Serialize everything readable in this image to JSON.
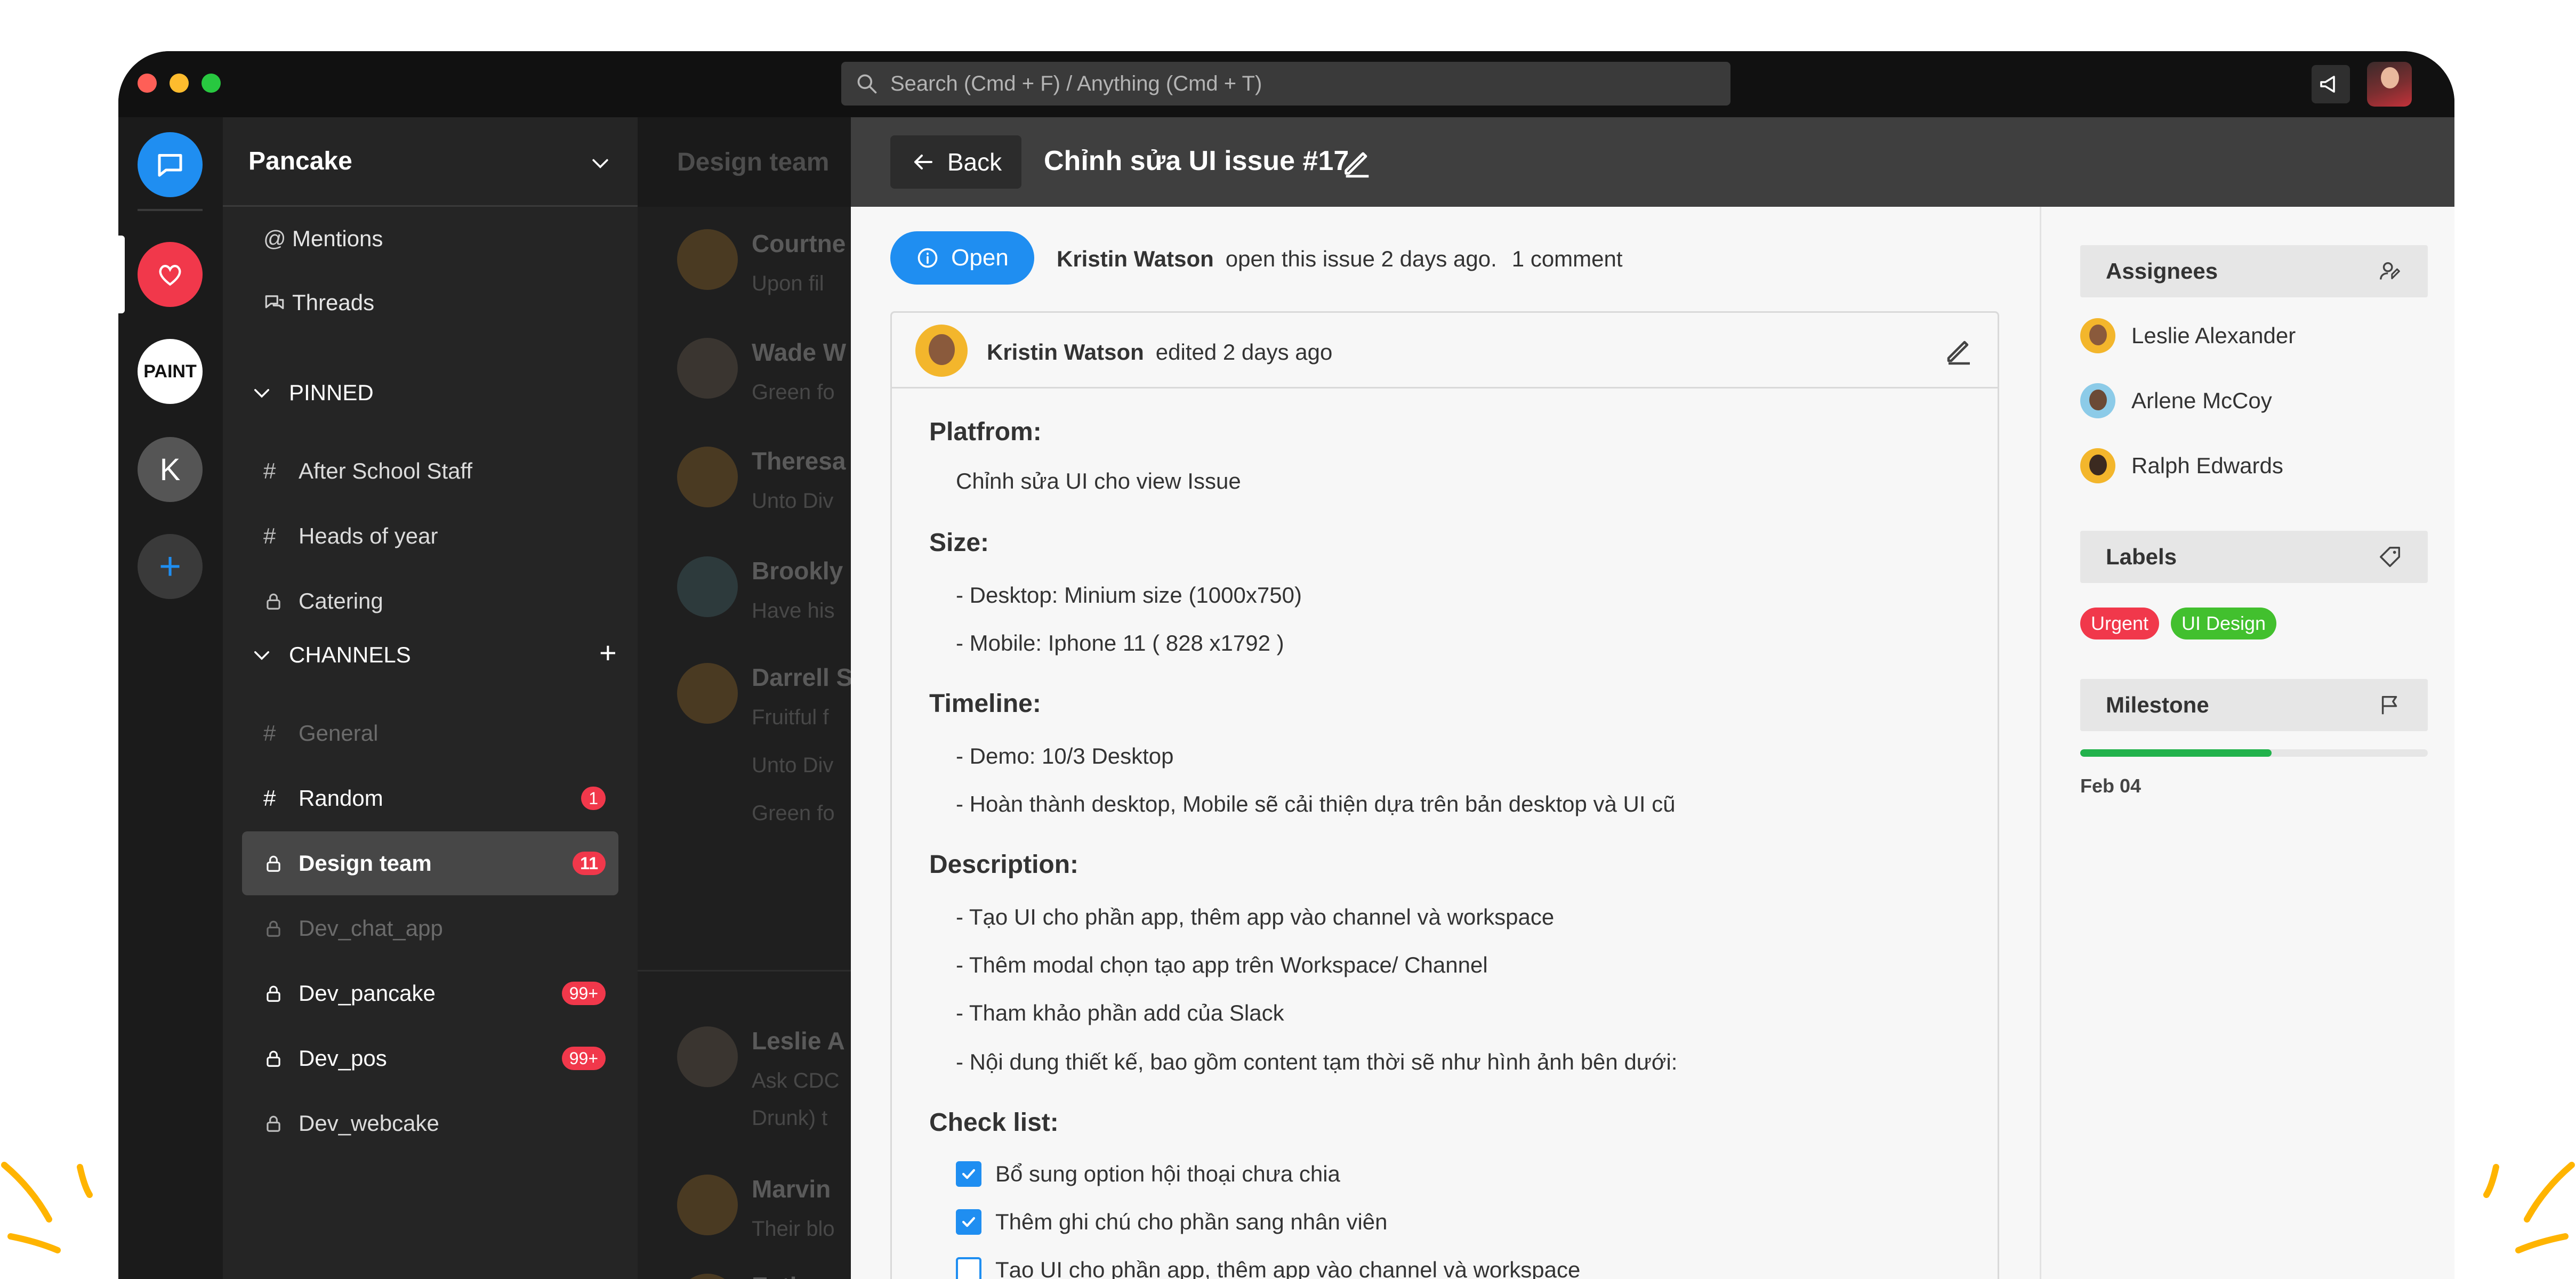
{
  "titlebar": {
    "search_placeholder": "Search (Cmd + F) / Anything (Cmd + T)"
  },
  "rail": {
    "workspaces": [
      {
        "name": "chat",
        "icon": "chat-bubble-icon"
      },
      {
        "name": "heart",
        "icon": "heart-icon"
      },
      {
        "name": "paint",
        "label": "PAINT"
      },
      {
        "name": "k",
        "label": "K"
      },
      {
        "name": "add",
        "label": "+"
      }
    ]
  },
  "sidebar": {
    "workspace_name": "Pancake",
    "mentions": "Mentions",
    "threads": "Threads",
    "pinned_label": "PINNED",
    "pinned": [
      {
        "label": "After School Staff",
        "icon": "#"
      },
      {
        "label": "Heads of year",
        "icon": "#"
      },
      {
        "label": "Catering",
        "icon": "lock-icon"
      }
    ],
    "channels_label": "CHANNELS",
    "channels": [
      {
        "label": "General",
        "icon": "#",
        "state": "muted"
      },
      {
        "label": "Random",
        "icon": "#",
        "badge": "1"
      },
      {
        "label": "Design team",
        "icon": "lock-icon",
        "badge": "11",
        "state": "active"
      },
      {
        "label": "Dev_chat_app",
        "icon": "lock-icon",
        "state": "muted"
      },
      {
        "label": "Dev_pancake",
        "icon": "lock-icon",
        "badge": "99+"
      },
      {
        "label": "Dev_pos",
        "icon": "lock-icon",
        "badge": "99+"
      },
      {
        "label": "Dev_webcake",
        "icon": "lock-icon"
      }
    ]
  },
  "chat_bg": {
    "title": "Design team",
    "messages": [
      {
        "name": "Courtne",
        "text": "Upon fil"
      },
      {
        "name": "Wade W",
        "text": "Green fo"
      },
      {
        "name": "Theresa",
        "text": "Unto Div"
      },
      {
        "name": "Brookly",
        "text": "Have his"
      },
      {
        "name": "Darrell S",
        "text": "Fruitful f",
        "extra": [
          "Unto Div",
          "Green fo"
        ]
      },
      {
        "name": "Leslie A",
        "text": "Ask CDC",
        "extra": [
          "Drunk) t"
        ]
      },
      {
        "name": "Marvin",
        "text": "Their blo"
      },
      {
        "name": "Esther",
        "text": ""
      }
    ]
  },
  "issue": {
    "back_label": "Back",
    "title": "Chỉnh sửa UI issue #17",
    "status": "Open",
    "author": "Kristin Watson",
    "opened_text": "open this issue 2 days ago.",
    "comments": "1 comment",
    "edited_text": "edited 2 days ago",
    "sections": {
      "platform_title": "Platfrom:",
      "platform_line": "Chỉnh sửa UI cho view Issue",
      "size_title": "Size:",
      "size_lines": [
        "- Desktop: Minium size (1000x750)",
        "- Mobile: Iphone 11 ( 828 x1792 )"
      ],
      "timeline_title": "Timeline:",
      "timeline_lines": [
        "-  Demo: 10/3  Desktop",
        "-  Hoàn thành desktop, Mobile sẽ cải thiện dựa trên bản desktop và UI cũ"
      ],
      "description_title": "Description:",
      "description_lines": [
        "- Tạo UI cho phần app, thêm app vào channel và workspace",
        "- Thêm modal chọn tạo app trên Workspace/ Channel",
        "- Tham khảo phần add của Slack",
        "-  Nội dung thiết kế, bao gồm content tạm thời sẽ như hình ảnh bên dưới:"
      ],
      "checklist_title": "Check list:",
      "checklist": [
        {
          "label": "Bổ sung option hội thoại chưa chia",
          "checked": true
        },
        {
          "label": "Thêm ghi chú cho phần sang nhân viên",
          "checked": true
        },
        {
          "label": "Tạo UI cho phần app, thêm app vào channel và workspace",
          "checked": false
        }
      ]
    }
  },
  "details": {
    "assignees_title": "Assignees",
    "assignees": [
      "Leslie Alexander",
      "Arlene McCoy",
      "Ralph Edwards"
    ],
    "labels_title": "Labels",
    "labels": [
      {
        "text": "Urgent",
        "color": "#f1384b"
      },
      {
        "text": "UI Design",
        "color": "#42c02e"
      }
    ],
    "milestone_title": "Milestone",
    "milestone_progress": 0.55,
    "milestone_date": "Feb 04"
  },
  "colors": {
    "accent": "#1f8ef1",
    "badge": "#f1384b",
    "success": "#22b24c"
  }
}
